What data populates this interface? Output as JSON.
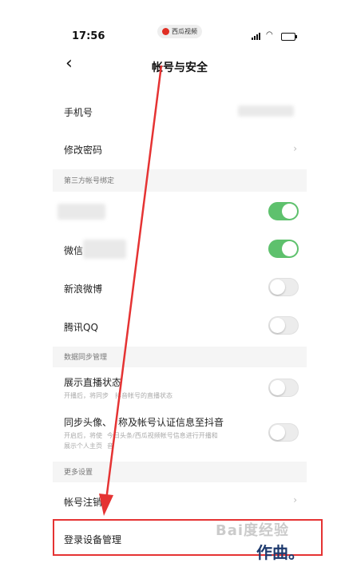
{
  "status_bar": {
    "time": "17:56",
    "app_badge": "西瓜视频"
  },
  "nav": {
    "title": "帐号与安全"
  },
  "rows": {
    "phone": "手机号",
    "change_password": "修改密码",
    "third_party_header": "第三方帐号绑定",
    "wechat": "微信",
    "weibo": "新浪微博",
    "qq": "腾讯QQ",
    "data_sync_header": "数据同步管理",
    "live_status": "展示直播状态",
    "live_status_desc": "开播后，将同步",
    "live_status_desc_tail": "抖音帐号的直播状态",
    "sync_profile": "同步头像、",
    "sync_profile_tail": "称及帐号认证信息至抖音",
    "sync_profile_desc": "开启后，将使",
    "sync_profile_desc_mid": "今日头条/西瓜视频帐号信息进行开播和",
    "sync_profile_desc2": "展示个人主页",
    "sync_profile_desc2_tail": "音",
    "more_header": "更多设置",
    "deregister": "帐号注销",
    "device_mgmt": "登录设备管理"
  },
  "toggles": {
    "blurred_account": true,
    "wechat": true,
    "weibo": false,
    "qq": false,
    "live_status": false,
    "sync_profile": false
  },
  "overlay": {
    "watermark": "Bai度经验",
    "corner_text": "作曲。"
  },
  "colors": {
    "toggle_on": "#5ec16d",
    "highlight": "#e53333",
    "arrow": "#e53333"
  }
}
